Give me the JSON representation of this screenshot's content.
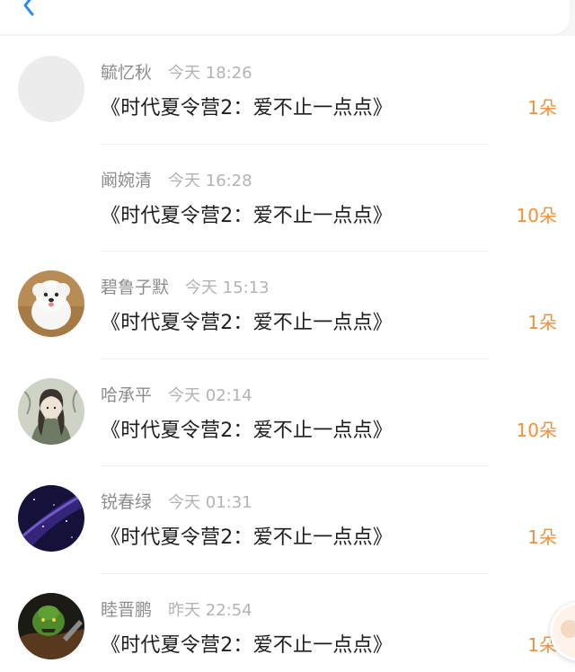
{
  "header": {
    "back_icon": "chevron-left-icon",
    "accent_color": "#2a8cf0"
  },
  "colors": {
    "count_color": "#f0913a",
    "name_color": "#8d8d8d",
    "time_color": "#b3b3b3",
    "title_color": "#1e1e1e"
  },
  "entries": [
    {
      "name": "毓忆秋",
      "time": "今天 18:26",
      "title": "《时代夏令营2：爱不止一点点》",
      "count": "1朵",
      "avatar": "default-avatar"
    },
    {
      "name": "阚婉清",
      "time": "今天 16:28",
      "title": "《时代夏令营2：爱不止一点点》",
      "count": "10朵",
      "avatar": "none"
    },
    {
      "name": "碧鲁子默",
      "time": "今天 15:13",
      "title": "《时代夏令营2：爱不止一点点》",
      "count": "1朵",
      "avatar": "white-dog"
    },
    {
      "name": "哈承平",
      "time": "今天 02:14",
      "title": "《时代夏令营2：爱不止一点点》",
      "count": "10朵",
      "avatar": "ancient-costume-figure"
    },
    {
      "name": "锐春绿",
      "time": "今天 01:31",
      "title": "《时代夏令营2：爱不止一点点》",
      "count": "1朵",
      "avatar": "purple-galaxy"
    },
    {
      "name": "睦晋鹏",
      "time": "昨天 22:54",
      "title": "《时代夏令营2：爱不止一点点》",
      "count": "1朵",
      "avatar": "green-monster"
    }
  ]
}
